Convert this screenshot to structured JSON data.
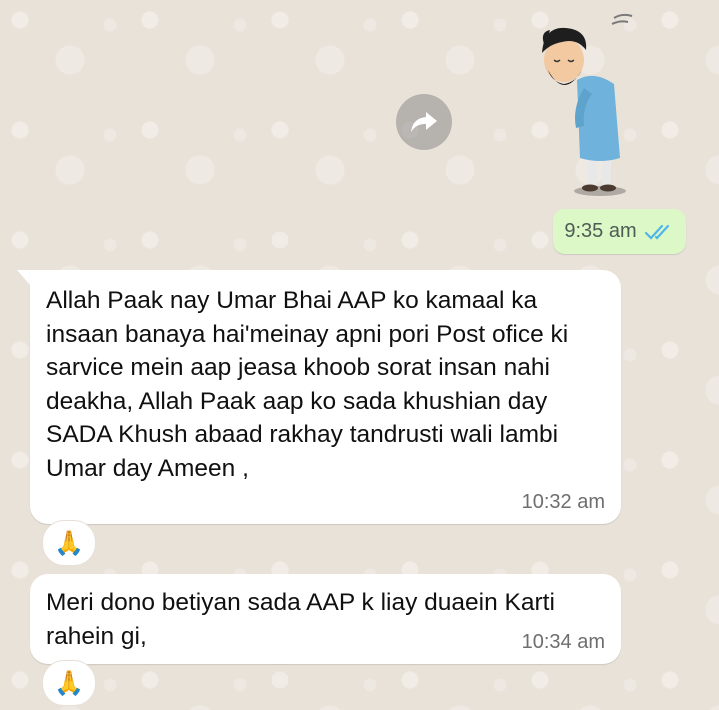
{
  "sent_message": {
    "sticker_icon": "bowing-man-sticker",
    "forward_icon": "forward-arrow-icon",
    "time": "9:35 am",
    "status_icon": "double-check-blue-icon"
  },
  "messages": [
    {
      "text": "Allah Paak nay Umar Bhai AAP ko kamaal ka insaan banaya hai'meinay apni pori Post ofice ki sarvice mein aap jeasa khoob sorat insan nahi deakha, Allah Paak aap ko sada khushian day SADA Khush abaad rakhay tandrusti wali lambi Umar day Ameen ,",
      "time": "10:32 am",
      "reaction": "🙏"
    },
    {
      "text": "Meri dono betiyan sada AAP k liay duaein Karti rahein gi,",
      "time": "10:34 am",
      "reaction": "🙏"
    }
  ],
  "colors": {
    "wallpaper": "#e9e2d9",
    "outgoing_bubble": "#dcf8c6",
    "incoming_bubble": "#ffffff",
    "read_ticks": "#4fb6ec"
  }
}
